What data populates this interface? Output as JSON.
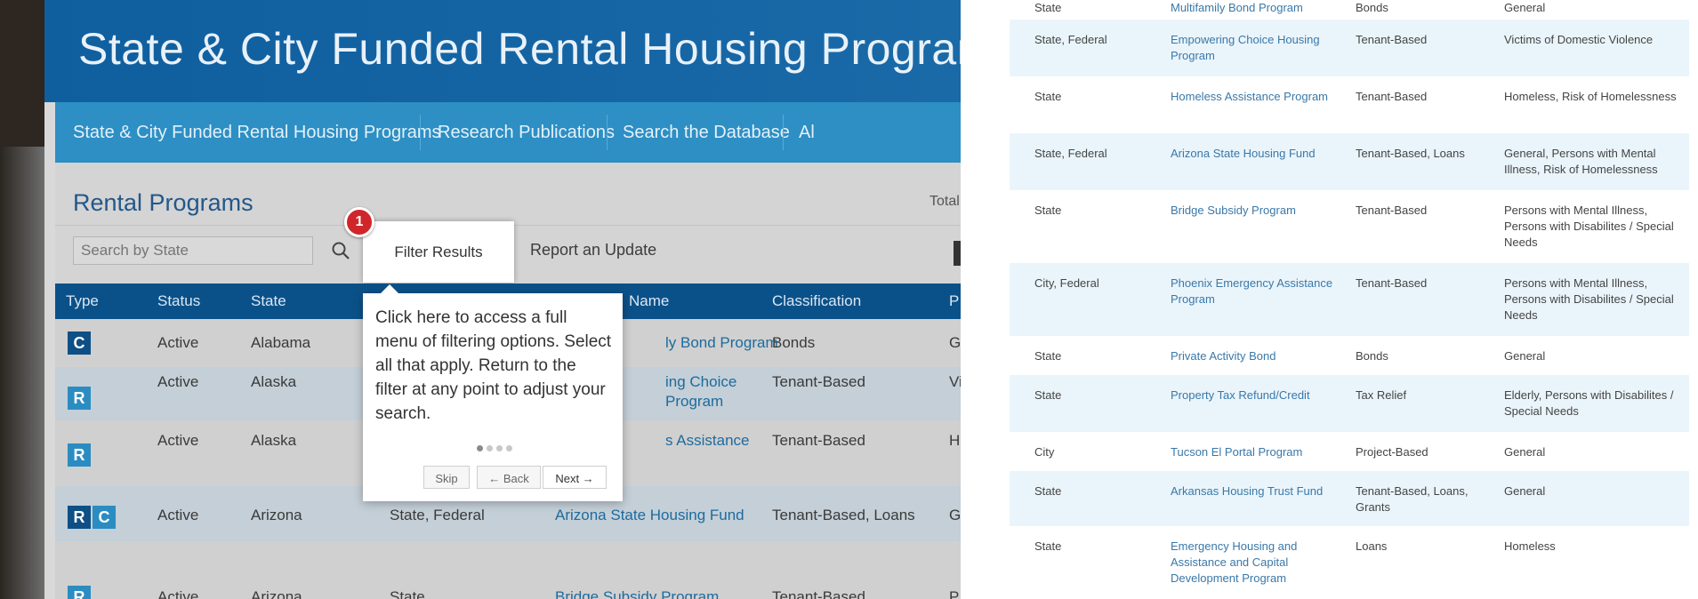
{
  "site": {
    "title": "State & City Funded Rental Housing Programs",
    "nav": [
      "State & City Funded Rental Housing Programs",
      "Research Publications",
      "Search the Database",
      "Al"
    ]
  },
  "page": {
    "title": "Rental Programs",
    "total_label": "Total:"
  },
  "toolbar": {
    "search_placeholder": "Search by State",
    "filter_label": "Filter Results",
    "report_label": "Report an Update"
  },
  "tour": {
    "step": "1",
    "text": "Click here to access a full menu of filtering options. Select all that apply. Return to the filter at any point to adjust your search.",
    "skip": "Skip",
    "back": "← Back",
    "next": "Next →",
    "steps_total": 4,
    "active_step_index": 0
  },
  "table": {
    "headers": [
      "Type",
      "Status",
      "State",
      "Name",
      "Classification",
      "P"
    ],
    "rows": [
      {
        "type": [
          "C"
        ],
        "status": "Active",
        "state": "Alabama",
        "funding": "",
        "name": "ly Bond Program",
        "name2": "",
        "classification": "Bonds",
        "pop": "G"
      },
      {
        "type": [
          "R"
        ],
        "status": "Active",
        "state": "Alaska",
        "funding": "",
        "name": "ing Choice",
        "name2": "Program",
        "classification": "Tenant-Based",
        "pop": "Vi"
      },
      {
        "type": [
          "R"
        ],
        "status": "Active",
        "state": "Alaska",
        "funding": "",
        "name": "s Assistance",
        "name2": "",
        "classification": "Tenant-Based",
        "pop": "H"
      },
      {
        "type": [
          "R",
          "C"
        ],
        "status": "Active",
        "state": "Arizona",
        "funding": "State, Federal",
        "name": "Arizona State Housing Fund",
        "name2": "",
        "classification": "Tenant-Based, Loans",
        "pop": "G"
      },
      {
        "type": [
          "R"
        ],
        "status": "Active",
        "state": "Arizona",
        "funding": "State",
        "name": "Bridge Subsidy Program",
        "name2": "",
        "classification": "Tenant-Based",
        "pop": "P"
      }
    ]
  },
  "right_table": {
    "rows": [
      {
        "funding": "State",
        "name": "Multifamily Bond Program",
        "classification": "Bonds",
        "population": "General"
      },
      {
        "funding": "State, Federal",
        "name": "Empowering Choice Housing Program",
        "classification": "Tenant-Based",
        "population": "Victims of Domestic Violence"
      },
      {
        "funding": "State",
        "name": "Homeless Assistance Program",
        "classification": "Tenant-Based",
        "population": "Homeless, Risk of Homelessness"
      },
      {
        "funding": "State, Federal",
        "name": "Arizona State Housing Fund",
        "classification": "Tenant-Based, Loans",
        "population": "General, Persons with Mental Illness, Risk of Homelessness"
      },
      {
        "funding": "State",
        "name": "Bridge Subsidy Program",
        "classification": "Tenant-Based",
        "population": "Persons with Mental Illness, Persons with Disabilites / Special Needs"
      },
      {
        "funding": "City, Federal",
        "name": "Phoenix Emergency Assistance Program",
        "classification": "Tenant-Based",
        "population": "Persons with Mental Illness, Persons with Disabilites / Special Needs"
      },
      {
        "funding": "State",
        "name": "Private Activity Bond",
        "classification": "Bonds",
        "population": "General"
      },
      {
        "funding": "State",
        "name": "Property Tax Refund/Credit",
        "classification": "Tax Relief",
        "population": "Elderly, Persons with Disabilites / Special Needs"
      },
      {
        "funding": "City",
        "name": "Tucson El Portal Program",
        "classification": "Project-Based",
        "population": "General"
      },
      {
        "funding": "State",
        "name": "Arkansas Housing Trust Fund",
        "classification": "Tenant-Based, Loans, Grants",
        "population": "General"
      },
      {
        "funding": "State",
        "name": "Emergency Housing and Assistance and Capital Development Program",
        "classification": "Loans",
        "population": "Homeless"
      }
    ]
  },
  "colors": {
    "banner": "#1565a5",
    "nav": "#2d8fc4",
    "table_header": "#0b5189",
    "badge": "#d0262a",
    "link": "#3a78a8",
    "alt_row": "#eaf5fb"
  }
}
